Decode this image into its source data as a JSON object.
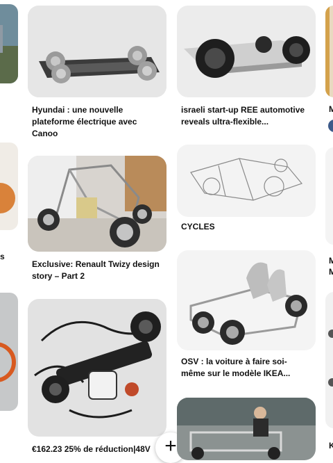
{
  "pins": {
    "col1": {
      "first_label": "Hyundai : une nouvelle plateforme électrique avec Canoo",
      "first_line1": "Hyundai : une nouvelle",
      "first_line2": "plateforme électrique avec",
      "first_line3": "Canoo",
      "second_line1": "Exclusive: Renault Twizy design",
      "second_line2": "story – Part 2",
      "third_line1": "€162.23 25% de réduction|48V"
    },
    "col2": {
      "first_line1": "israeli start-up REE automotive",
      "first_line2": "reveals ultra-flexible...",
      "second_label": "CYCLES",
      "third_line1": "OSV : la voiture à faire soi-",
      "third_line2": "même sur le modèle IKEA..."
    },
    "right_edge": {
      "t1": "M",
      "t2": "M",
      "t3": "M",
      "t4": "K"
    },
    "left_edge": {
      "t1": "s"
    }
  },
  "controls": {
    "plus_glyph": "+"
  },
  "colors": {
    "card_bg": "#e9e9e9",
    "text": "#111111"
  }
}
